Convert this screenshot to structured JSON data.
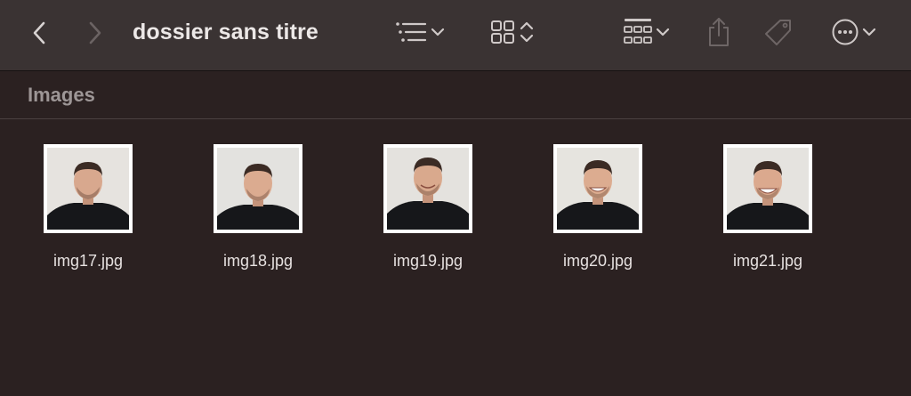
{
  "window": {
    "title": "dossier sans titre"
  },
  "toolbar": {
    "icons": [
      "chevron-left-icon",
      "chevron-right-icon",
      "list-view-icon",
      "chevron-down-icon",
      "grid-view-icon",
      "up-down-chevron-icon",
      "group-icon",
      "chevron-down-icon",
      "share-icon",
      "tag-icon",
      "more-icon",
      "chevron-down-icon"
    ]
  },
  "section": {
    "title": "Images"
  },
  "files": [
    {
      "name": "img17.jpg"
    },
    {
      "name": "img18.jpg"
    },
    {
      "name": "img19.jpg"
    },
    {
      "name": "img20.jpg"
    },
    {
      "name": "img21.jpg"
    }
  ],
  "colors": {
    "toolbar_bg": "#3a3333",
    "window_bg": "#2b2121",
    "text": "#e6e1e0",
    "muted_text": "#9d9696"
  }
}
